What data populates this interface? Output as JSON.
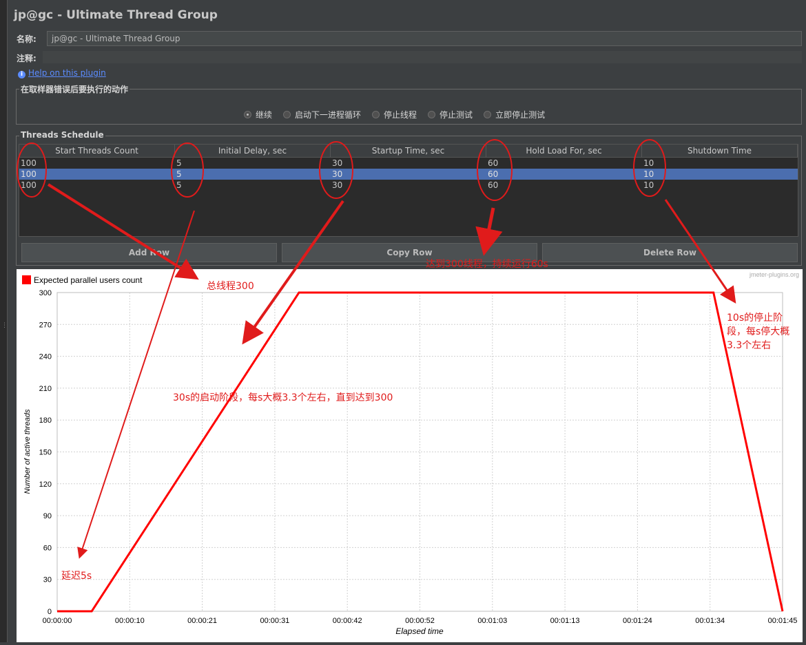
{
  "title": "jp@gc - Ultimate Thread Group",
  "name_field": {
    "label": "名称:",
    "value": "jp@gc - Ultimate Thread Group"
  },
  "comments_field": {
    "label": "注释:",
    "value": ""
  },
  "help_link": "Help on this plugin",
  "error_action": {
    "title": "在取样器错误后要执行的动作",
    "options": [
      "继续",
      "启动下一进程循环",
      "停止线程",
      "停止测试",
      "立即停止测试"
    ],
    "selected": "继续"
  },
  "schedule": {
    "title": "Threads Schedule",
    "columns": [
      "Start Threads Count",
      "Initial Delay, sec",
      "Startup Time, sec",
      "Hold Load For, sec",
      "Shutdown Time"
    ],
    "rows": [
      [
        "100",
        "5",
        "30",
        "60",
        "10"
      ],
      [
        "100",
        "5",
        "30",
        "60",
        "10"
      ],
      [
        "100",
        "5",
        "30",
        "60",
        "10"
      ]
    ],
    "selected_row": 1,
    "buttons": {
      "add": "Add Row",
      "copy": "Copy Row",
      "delete": "Delete Row"
    }
  },
  "chart_data": {
    "type": "line",
    "legend": "Expected parallel users count",
    "watermark": "jmeter-plugins.org",
    "xlabel": "Elapsed time",
    "ylabel": "Number of active threads",
    "yticks": [
      "300",
      "270",
      "240",
      "210",
      "180",
      "150",
      "120",
      "90",
      "60",
      "30",
      "0"
    ],
    "xticks": [
      "00:00:00",
      "00:00:10",
      "00:00:21",
      "00:00:31",
      "00:00:42",
      "00:00:52",
      "00:01:03",
      "00:01:13",
      "00:01:24",
      "00:01:34",
      "00:01:45"
    ],
    "ylim": [
      0,
      300
    ],
    "xlim_seconds": [
      0,
      105
    ],
    "grid": true,
    "series": [
      {
        "name": "Expected parallel users count",
        "color": "#ff0000",
        "x_seconds": [
          0,
          5,
          35,
          95,
          105
        ],
        "y": [
          0,
          0,
          300,
          300,
          0
        ]
      }
    ]
  },
  "annotations": {
    "total": "总线程300",
    "hold": "达到300线程，持续运行60s",
    "startup": "30s的启动阶段，每s大概3.3个左右，直到达到300",
    "shutdown_1": "10s的停止阶",
    "shutdown_2": "段，每s停大概",
    "shutdown_3": "3.3个左右",
    "delay": "延迟5s"
  },
  "colors": {
    "annotation": "#e01b1b",
    "selection": "#4b6eaf",
    "line": "#ff0000"
  }
}
